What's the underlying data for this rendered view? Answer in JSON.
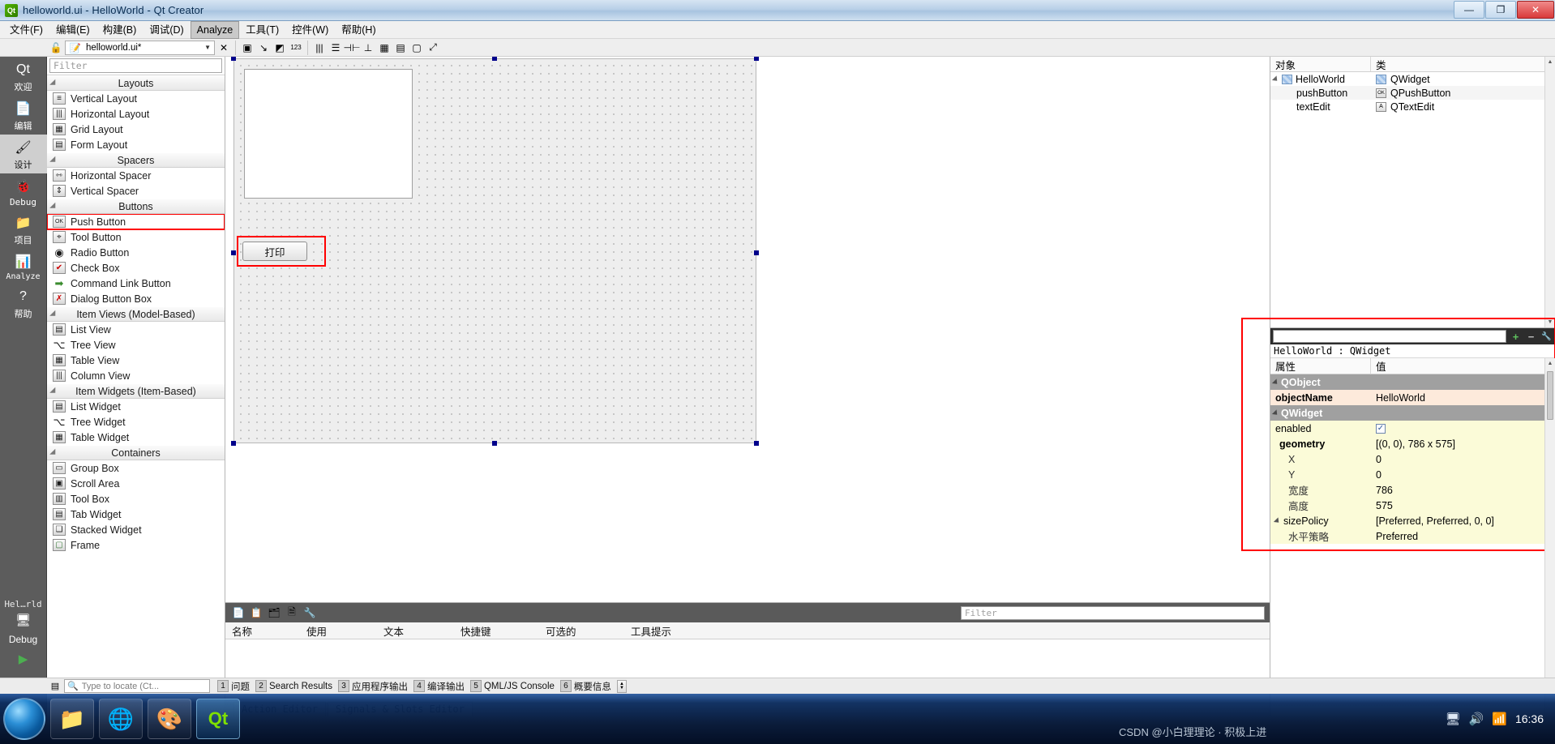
{
  "window": {
    "title": "helloworld.ui - HelloWorld - Qt Creator",
    "logo_text": "Qt",
    "minimize": "—",
    "maximize": "❐",
    "close": "✕"
  },
  "menubar": {
    "items": [
      {
        "label": "文件(F)",
        "active": false
      },
      {
        "label": "编辑(E)",
        "active": false
      },
      {
        "label": "构建(B)",
        "active": false
      },
      {
        "label": "调试(D)",
        "active": false
      },
      {
        "label": "Analyze",
        "active": true
      },
      {
        "label": "工具(T)",
        "active": false
      },
      {
        "label": "控件(W)",
        "active": false
      },
      {
        "label": "帮助(H)",
        "active": false
      }
    ]
  },
  "toolbar": {
    "lock_icon": "🔓",
    "file_icon": "📝",
    "current_file": "helloworld.ui*",
    "dropdown_arrow": "▼",
    "close_icon": "✕",
    "buttons": [
      {
        "name": "edit-widgets-icon",
        "glyph": "▣"
      },
      {
        "name": "edit-signals-slots-icon",
        "glyph": "↘"
      },
      {
        "name": "edit-buddies-icon",
        "glyph": "◩"
      },
      {
        "name": "edit-tab-order-icon",
        "glyph": "123"
      },
      {
        "name": "layout-horizontally-icon",
        "glyph": "|||"
      },
      {
        "name": "layout-vertically-icon",
        "glyph": "☰"
      },
      {
        "name": "layout-splitter-h-icon",
        "glyph": "⊣⊢"
      },
      {
        "name": "layout-splitter-v-icon",
        "glyph": "⊥"
      },
      {
        "name": "layout-grid-icon",
        "glyph": "▦"
      },
      {
        "name": "layout-form-icon",
        "glyph": "▤"
      },
      {
        "name": "break-layout-icon",
        "glyph": "▢"
      },
      {
        "name": "adjust-size-icon",
        "glyph": "⤢"
      }
    ]
  },
  "modebar": {
    "modes": [
      {
        "label": "欢迎",
        "icon": "Qt",
        "selected": false,
        "name": "welcome"
      },
      {
        "label": "编辑",
        "icon": "📄",
        "selected": false,
        "name": "edit"
      },
      {
        "label": "设计",
        "icon": "🖌",
        "selected": true,
        "name": "design"
      },
      {
        "label": "Debug",
        "icon": "🐞",
        "selected": false,
        "name": "debug"
      },
      {
        "label": "项目",
        "icon": "📁",
        "selected": false,
        "name": "projects"
      },
      {
        "label": "Analyze",
        "icon": "📊",
        "selected": false,
        "name": "analyze"
      },
      {
        "label": "帮助",
        "icon": "?",
        "selected": false,
        "name": "help"
      }
    ],
    "project_name": "Hel…rld",
    "kit_label": "Debug",
    "run_buttons": [
      {
        "name": "run-button",
        "glyph": "▶"
      },
      {
        "name": "debug-button",
        "glyph": "▶"
      },
      {
        "name": "build-button",
        "glyph": "🔨"
      }
    ]
  },
  "widgetbox": {
    "filter_placeholder": "Filter",
    "groups": [
      {
        "title": "Layouts",
        "items": [
          {
            "label": "Vertical Layout",
            "icon": "≡",
            "highlighted": false
          },
          {
            "label": "Horizontal Layout",
            "icon": "|||",
            "highlighted": false
          },
          {
            "label": "Grid Layout",
            "icon": "▦",
            "highlighted": false
          },
          {
            "label": "Form Layout",
            "icon": "▤",
            "highlighted": false
          }
        ]
      },
      {
        "title": "Spacers",
        "items": [
          {
            "label": "Horizontal Spacer",
            "icon": "⇿",
            "highlighted": false
          },
          {
            "label": "Vertical Spacer",
            "icon": "⇕",
            "highlighted": false
          }
        ]
      },
      {
        "title": "Buttons",
        "items": [
          {
            "label": "Push Button",
            "icon": "OK",
            "highlighted": true
          },
          {
            "label": "Tool Button",
            "icon": "⌖",
            "highlighted": false
          },
          {
            "label": "Radio Button",
            "icon": "◉",
            "highlighted": false
          },
          {
            "label": "Check Box",
            "icon": "✔",
            "highlighted": false
          },
          {
            "label": "Command Link Button",
            "icon": "➡",
            "highlighted": false
          },
          {
            "label": "Dialog Button Box",
            "icon": "✗",
            "highlighted": false
          }
        ]
      },
      {
        "title": "Item Views (Model-Based)",
        "items": [
          {
            "label": "List View",
            "icon": "▤",
            "highlighted": false
          },
          {
            "label": "Tree View",
            "icon": "⌥",
            "highlighted": false
          },
          {
            "label": "Table View",
            "icon": "▦",
            "highlighted": false
          },
          {
            "label": "Column View",
            "icon": "|||",
            "highlighted": false
          }
        ]
      },
      {
        "title": "Item Widgets (Item-Based)",
        "items": [
          {
            "label": "List Widget",
            "icon": "▤",
            "highlighted": false
          },
          {
            "label": "Tree Widget",
            "icon": "⌥",
            "highlighted": false
          },
          {
            "label": "Table Widget",
            "icon": "▦",
            "highlighted": false
          }
        ]
      },
      {
        "title": "Containers",
        "items": [
          {
            "label": "Group Box",
            "icon": "▭",
            "highlighted": false
          },
          {
            "label": "Scroll Area",
            "icon": "▣",
            "highlighted": false
          },
          {
            "label": "Tool Box",
            "icon": "▥",
            "highlighted": false
          },
          {
            "label": "Tab Widget",
            "icon": "▤",
            "highlighted": false
          },
          {
            "label": "Stacked Widget",
            "icon": "❏",
            "highlighted": false
          },
          {
            "label": "Frame",
            "icon": "▢",
            "highlighted": false
          }
        ]
      }
    ]
  },
  "form": {
    "pushbutton_text": "打印",
    "textedit_text": ""
  },
  "action_editor": {
    "toolbar_icons": [
      {
        "name": "new-action-icon",
        "glyph": "📄"
      },
      {
        "name": "copy-action-icon",
        "glyph": "📋"
      },
      {
        "name": "edit-action-icon",
        "glyph": "🗂"
      },
      {
        "name": "delete-action-icon",
        "glyph": "🗎"
      },
      {
        "name": "configure-icon",
        "glyph": "🔧"
      }
    ],
    "filter_placeholder": "Filter",
    "columns": [
      "名称",
      "使用",
      "文本",
      "快捷键",
      "可选的",
      "工具提示"
    ],
    "rows": [],
    "tabs": [
      {
        "label": "Action Editor",
        "selected": false
      },
      {
        "label": "Signals & Slots Editor",
        "selected": true
      }
    ]
  },
  "object_inspector": {
    "columns": [
      "对象",
      "类"
    ],
    "rows": [
      {
        "object": "HelloWorld",
        "class": "QWidget",
        "indent": 0,
        "expandable": true,
        "icon": "widget-icon",
        "class_icon": "qwidget-icon"
      },
      {
        "object": "pushButton",
        "class": "QPushButton",
        "indent": 1,
        "expandable": false,
        "icon": "",
        "class_icon": "pushbutton-icon"
      },
      {
        "object": "textEdit",
        "class": "QTextEdit",
        "indent": 1,
        "expandable": false,
        "icon": "",
        "class_icon": "textedit-icon"
      }
    ]
  },
  "property_editor": {
    "filter_placeholder": "",
    "add_label": "+",
    "remove_label": "−",
    "configure_label": "🔧",
    "object_line": "HelloWorld : QWidget",
    "columns": [
      "属性",
      "值"
    ],
    "rows": [
      {
        "name": "QObject",
        "value": "",
        "type": "group"
      },
      {
        "name": "objectName",
        "value": "HelloWorld",
        "type": "peach"
      },
      {
        "name": "QWidget",
        "value": "",
        "type": "group"
      },
      {
        "name": "enabled",
        "value": "checkbox",
        "type": "yellow"
      },
      {
        "name": "geometry",
        "value": "[(0, 0), 786 x 575]",
        "type": "yellow-bold"
      },
      {
        "name": "X",
        "value": "0",
        "type": "sub"
      },
      {
        "name": "Y",
        "value": "0",
        "type": "sub"
      },
      {
        "name": "宽度",
        "value": "786",
        "type": "sub"
      },
      {
        "name": "高度",
        "value": "575",
        "type": "sub"
      },
      {
        "name": "sizePolicy",
        "value": "[Preferred, Preferred, 0, 0]",
        "type": "yellow"
      },
      {
        "name": "水平策略",
        "value": "Preferred",
        "type": "sub"
      }
    ]
  },
  "statusbar": {
    "locator_placeholder": "Type to locate (Ct...",
    "locator_icon": "🔍",
    "panes": [
      {
        "num": "1",
        "label": "问题"
      },
      {
        "num": "2",
        "label": "Search Results"
      },
      {
        "num": "3",
        "label": "应用程序输出"
      },
      {
        "num": "4",
        "label": "编译输出"
      },
      {
        "num": "5",
        "label": "QML/JS Console"
      },
      {
        "num": "6",
        "label": "概要信息"
      }
    ]
  },
  "taskbar": {
    "apps": [
      {
        "name": "explorer",
        "glyph": "📁"
      },
      {
        "name": "browser",
        "glyph": "🌐"
      },
      {
        "name": "media",
        "glyph": "🎨"
      },
      {
        "name": "qtcreator",
        "glyph": "Qt"
      }
    ],
    "tray_icons": [
      "🖥",
      "🔊",
      "📶"
    ],
    "clock_time": "16:36",
    "watermark": "CSDN @小白理理论 · 积极上进"
  }
}
